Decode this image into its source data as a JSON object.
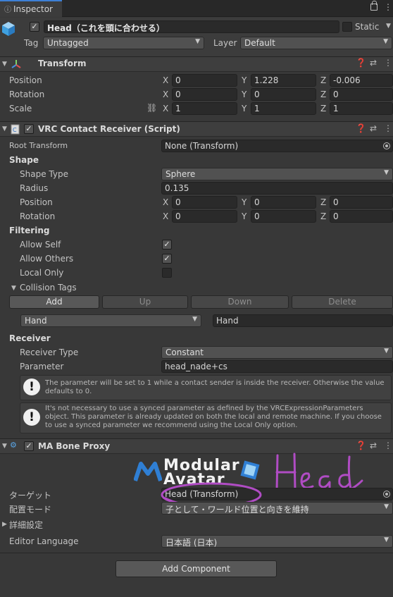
{
  "tab": {
    "title": "Inspector"
  },
  "gameobject": {
    "name": "Head（これを頭に合わせる）",
    "static_label": "Static",
    "tag_label": "Tag",
    "tag_value": "Untagged",
    "layer_label": "Layer",
    "layer_value": "Default"
  },
  "transform": {
    "title": "Transform",
    "position_label": "Position",
    "rotation_label": "Rotation",
    "scale_label": "Scale",
    "axis_x": "X",
    "axis_y": "Y",
    "axis_z": "Z",
    "position": {
      "x": "0",
      "y": "1.228",
      "z": "-0.006"
    },
    "rotation": {
      "x": "0",
      "y": "0",
      "z": "0"
    },
    "scale": {
      "x": "1",
      "y": "1",
      "z": "1"
    }
  },
  "receiver": {
    "title": "VRC Contact Receiver (Script)",
    "root_transform_label": "Root Transform",
    "root_transform_value": "None (Transform)",
    "shape_section": "Shape",
    "shape_type_label": "Shape Type",
    "shape_type_value": "Sphere",
    "radius_label": "Radius",
    "radius_value": "0.135",
    "position_label": "Position",
    "rotation_label": "Rotation",
    "position": {
      "x": "0",
      "y": "0",
      "z": "0"
    },
    "rotation": {
      "x": "0",
      "y": "0",
      "z": "0"
    },
    "filtering_section": "Filtering",
    "allow_self_label": "Allow Self",
    "allow_others_label": "Allow Others",
    "local_only_label": "Local Only",
    "allow_self": true,
    "allow_others": true,
    "local_only": false,
    "collision_tags_label": "Collision Tags",
    "btn_add": "Add",
    "btn_up": "Up",
    "btn_down": "Down",
    "btn_delete": "Delete",
    "tag_dropdown_value": "Hand",
    "tag_field_value": "Hand",
    "receiver_section": "Receiver",
    "receiver_type_label": "Receiver Type",
    "receiver_type_value": "Constant",
    "parameter_label": "Parameter",
    "parameter_value": "head_nade+cs",
    "help1": "The parameter will be set to 1 while a contact sender is inside the receiver.  Otherwise the value defaults to 0.",
    "help2": "It's not necessary to use a synced parameter as defined by the VRCExpressionParameters object.  This parameter is already updated on both the local and remote machine.  If you choose to use a synced parameter we recommend using the Local Only option."
  },
  "bone_proxy": {
    "title": "MA Bone Proxy",
    "logo_line1": "Modular",
    "logo_line2": "Avatar",
    "annotation": "Head",
    "target_label": "ターゲット",
    "target_value": "Head (Transform)",
    "placement_label": "配置モード",
    "placement_value": "子として・ワールド位置と向きを維持",
    "advanced_label": "詳細設定",
    "editor_language_label": "Editor Language",
    "editor_language_value": "日本語 (日本)"
  },
  "add_component": "Add Component",
  "colors": {
    "background": "#383838",
    "field": "#2a2a2a",
    "accent": "#3d7fd6",
    "annotation": "#b04cc4",
    "logo_blue": "#2f7fd4"
  }
}
